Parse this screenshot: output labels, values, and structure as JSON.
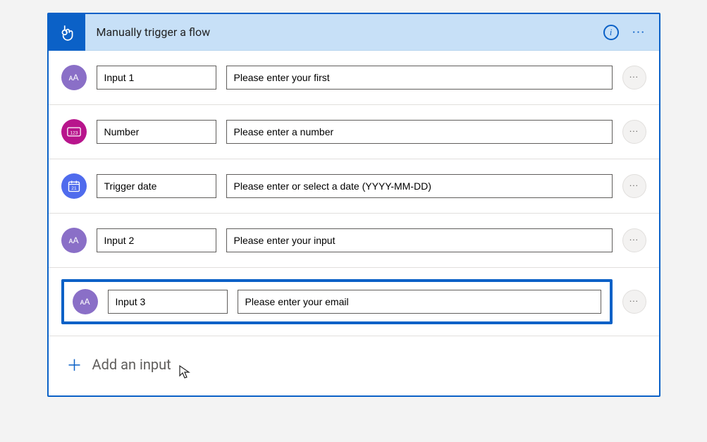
{
  "header": {
    "title": "Manually trigger a flow"
  },
  "rows": [
    {
      "type": "text",
      "glyph": "ᴀA",
      "name": "Input 1",
      "placeholder": "Please enter your first"
    },
    {
      "type": "number",
      "glyph": "123",
      "name": "Number",
      "placeholder": "Please enter a number"
    },
    {
      "type": "date",
      "glyph": "",
      "name": "Trigger date",
      "placeholder": "Please enter or select a date (YYYY-MM-DD)"
    },
    {
      "type": "text",
      "glyph": "ᴀA",
      "name": "Input 2",
      "placeholder": "Please enter your input"
    },
    {
      "type": "text",
      "glyph": "ᴀA",
      "name": "Input 3",
      "placeholder": "Please enter your email"
    }
  ],
  "highlight_index": 4,
  "addInput": {
    "label": "Add an input"
  }
}
